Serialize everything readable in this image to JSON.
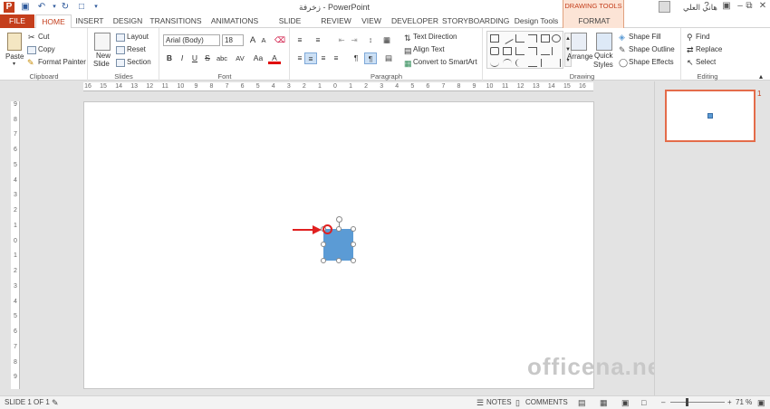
{
  "window": {
    "title": "زخرفة - PowerPoint"
  },
  "tabs": [
    "FILE",
    "HOME",
    "INSERT",
    "DESIGN",
    "TRANSITIONS",
    "ANIMATIONS",
    "SLIDE SHOW",
    "REVIEW",
    "VIEW",
    "DEVELOPER",
    "STORYBOARDING",
    "Design Tools",
    "FORMAT"
  ],
  "drawing_tools_label": "DRAWING TOOLS",
  "user": "هاني العلي",
  "clipboard": {
    "paste": "Paste",
    "cut": "Cut",
    "copy": "Copy",
    "format_painter": "Format Painter",
    "label": "Clipboard"
  },
  "slides": {
    "new_slide": "New",
    "new_slide2": "Slide",
    "layout": "Layout",
    "reset": "Reset",
    "section": "Section",
    "label": "Slides"
  },
  "font": {
    "name": "Arial (Body)",
    "size": "18",
    "bold": "B",
    "italic": "I",
    "underline": "U",
    "strike": "S",
    "shadow": "abc",
    "spacing": "AV",
    "case": "Aa",
    "color_letter": "A",
    "label": "Font",
    "grow": "A",
    "shrink": "A"
  },
  "paragraph": {
    "text_direction": "Text Direction",
    "align_text": "Align Text",
    "smartart": "Convert to SmartArt",
    "label": "Paragraph"
  },
  "drawing": {
    "arrange": "Arrange",
    "quick": "Quick",
    "styles": "Styles",
    "shape_fill": "Shape Fill",
    "shape_outline": "Shape Outline",
    "shape_effects": "Shape Effects",
    "label": "Drawing"
  },
  "editing": {
    "find": "Find",
    "replace": "Replace",
    "select": "Select",
    "label": "Editing"
  },
  "ruler": {
    "h": [
      "16",
      "15",
      "14",
      "13",
      "12",
      "11",
      "10",
      "9",
      "8",
      "7",
      "6",
      "5",
      "4",
      "3",
      "2",
      "1",
      "0",
      "1",
      "2",
      "3",
      "4",
      "5",
      "6",
      "7",
      "8",
      "9",
      "10",
      "11",
      "12",
      "13",
      "14",
      "15",
      "16"
    ],
    "v": [
      "9",
      "8",
      "7",
      "6",
      "5",
      "4",
      "3",
      "2",
      "1",
      "0",
      "1",
      "2",
      "3",
      "4",
      "5",
      "6",
      "7",
      "8",
      "9"
    ]
  },
  "thumb_number": "1",
  "watermark": "officena.net",
  "status": {
    "slide": "SLIDE 1 OF 1",
    "notes": "NOTES",
    "comments": "COMMENTS",
    "zoom": "71 %"
  },
  "colors": {
    "accent": "#c43e1c",
    "shape": "#5b9bd5",
    "arrow": "#e02020"
  }
}
